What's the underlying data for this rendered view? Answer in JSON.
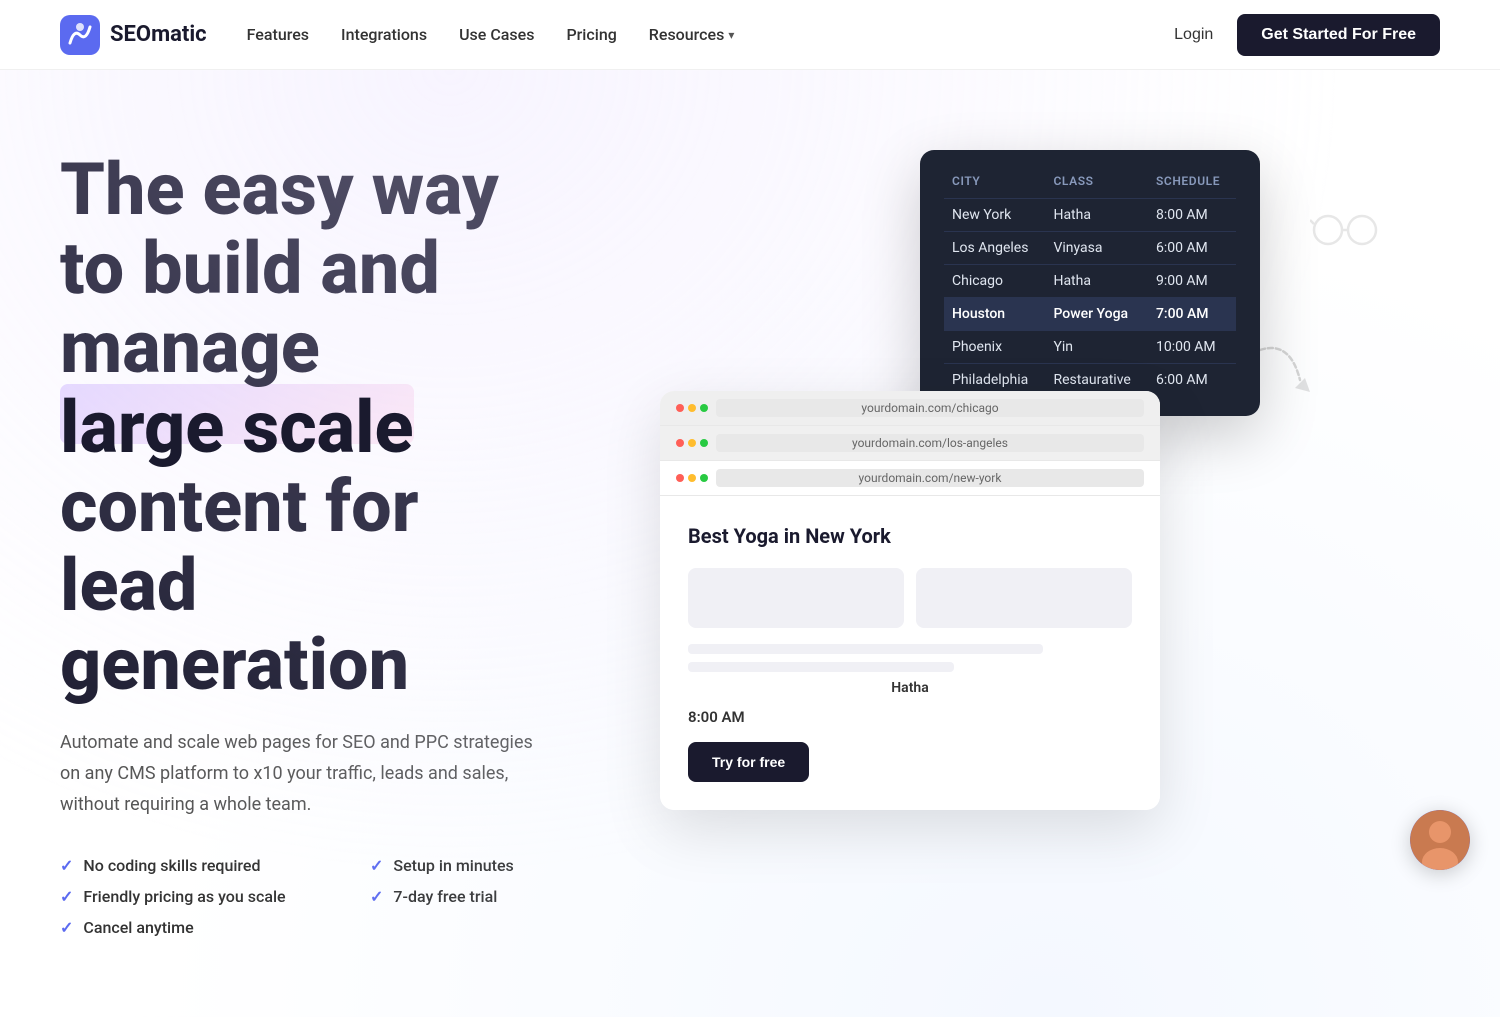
{
  "nav": {
    "logo_text": "SEOmatic",
    "links": [
      {
        "label": "Features",
        "href": "#"
      },
      {
        "label": "Integrations",
        "href": "#"
      },
      {
        "label": "Use Cases",
        "href": "#"
      },
      {
        "label": "Pricing",
        "href": "#"
      },
      {
        "label": "Resources",
        "href": "#",
        "has_chevron": true
      }
    ],
    "login_label": "Login",
    "cta_label": "Get Started For Free"
  },
  "hero": {
    "title_line1": "The easy way",
    "title_line2": "to build and",
    "title_line3": "manage",
    "title_highlight": "large scale",
    "title_line4": "content for",
    "title_line5": "lead",
    "title_line6": "generation",
    "subtitle": "Automate and scale web pages for SEO and PPC strategies on any CMS platform to x10 your traffic, leads and sales, without requiring a whole team.",
    "features": [
      "No coding skills required",
      "Setup in minutes",
      "Friendly pricing as you scale",
      "7-day free trial",
      "Cancel anytime"
    ]
  },
  "table_card": {
    "headers": [
      "CITY",
      "CLASS",
      "SCHEDULE"
    ],
    "rows": [
      {
        "city": "New York",
        "class": "Hatha",
        "schedule": "8:00 AM",
        "highlighted": false
      },
      {
        "city": "Los Angeles",
        "class": "Vinyasa",
        "schedule": "6:00 AM",
        "highlighted": false
      },
      {
        "city": "Chicago",
        "class": "Hatha",
        "schedule": "9:00 AM",
        "highlighted": false
      },
      {
        "city": "Houston",
        "class": "Power Yoga",
        "schedule": "7:00 AM",
        "highlighted": true
      },
      {
        "city": "Phoenix",
        "class": "Yin",
        "schedule": "10:00 AM",
        "highlighted": false
      },
      {
        "city": "Philadelphia",
        "class": "Restaurative",
        "schedule": "6:00 AM",
        "highlighted": false
      }
    ]
  },
  "browser_card": {
    "tabs": [
      {
        "url": "yourdomain.com/chicago"
      },
      {
        "url": "yourdomain.com/los-angeles"
      },
      {
        "url": "yourdomain.com/new-york"
      }
    ],
    "page_title": "Best Yoga in New York",
    "class_label": "Hatha",
    "time_label": "8:00 AM",
    "cta_label": "Try for free"
  },
  "avatar": {
    "emoji": "👤"
  }
}
